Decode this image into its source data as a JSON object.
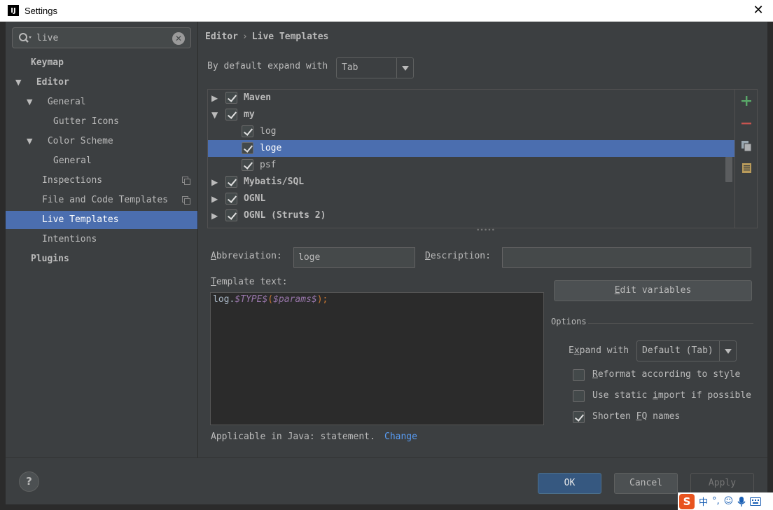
{
  "window": {
    "title": "Settings",
    "logo_text": "IJ"
  },
  "search": {
    "value": "live"
  },
  "sidebar": {
    "items": [
      {
        "label": "Keymap"
      },
      {
        "label": "Editor"
      },
      {
        "label": "General"
      },
      {
        "label": "Gutter Icons"
      },
      {
        "label": "Color Scheme"
      },
      {
        "label": "General"
      },
      {
        "label": "Inspections"
      },
      {
        "label": "File and Code Templates"
      },
      {
        "label": "Live Templates"
      },
      {
        "label": "Intentions"
      },
      {
        "label": "Plugins"
      }
    ]
  },
  "breadcrumb": {
    "part1": "Editor",
    "separator": "›",
    "part2": "Live Templates"
  },
  "expand_default": {
    "label": "By default expand with",
    "value": "Tab"
  },
  "templates": {
    "groups": [
      {
        "label": "Maven"
      },
      {
        "label": "my"
      },
      {
        "label": "log"
      },
      {
        "label": "loge"
      },
      {
        "label": "psf"
      },
      {
        "label": "Mybatis/SQL"
      },
      {
        "label": "OGNL"
      },
      {
        "label": "OGNL (Struts 2)"
      }
    ]
  },
  "form": {
    "abbreviation_label_u": "A",
    "abbreviation_label_rest": "bbreviation:",
    "abbreviation_value": "loge",
    "description_label_u": "D",
    "description_label_rest": "escription:",
    "description_value": "",
    "template_label_u": "T",
    "template_label_rest": "emplate text:",
    "code": {
      "a": "log.",
      "b": "$TYPE$",
      "c": "(",
      "d": "$params$",
      "e": ");"
    },
    "applicable_text": "Applicable in Java: statement.",
    "change_link": "Change",
    "edit_vars_u": "E",
    "edit_vars_rest": "dit variables"
  },
  "options": {
    "title": "Options",
    "expand_with_pre": "E",
    "expand_with_u": "x",
    "expand_with_rest": "pand with",
    "expand_value": "Default (Tab)",
    "reformat_u": "R",
    "reformat_rest": "eformat according to style",
    "static_pre": "Use static ",
    "static_u": "i",
    "static_rest": "mport if possible",
    "shorten_pre": "Shorten ",
    "shorten_u": "F",
    "shorten_rest": "Q names"
  },
  "footer": {
    "help": "?",
    "ok": "OK",
    "cancel": "Cancel",
    "apply": "Apply"
  },
  "tray": {
    "logo": "S",
    "ime": "中",
    "punct": "°,"
  }
}
